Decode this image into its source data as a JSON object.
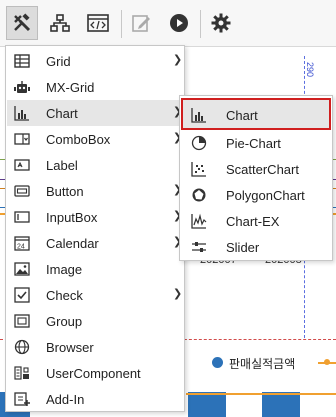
{
  "toolbar": {
    "buttons": [
      {
        "name": "tools-icon",
        "active": true
      },
      {
        "name": "tree-icon"
      },
      {
        "name": "code-window-icon"
      },
      {
        "name": "edit-icon"
      },
      {
        "name": "play-icon"
      },
      {
        "name": "gear-icon"
      }
    ]
  },
  "background": {
    "vertical_marker_label": "290",
    "x_labels": [
      "202007",
      "202008"
    ],
    "legend_label": "판매실적금액"
  },
  "menu": {
    "items": [
      {
        "label": "Grid",
        "icon": "grid-icon",
        "has_submenu": true
      },
      {
        "label": "MX-Grid",
        "icon": "robot-icon",
        "has_submenu": false
      },
      {
        "label": "Chart",
        "icon": "bar-chart-icon",
        "has_submenu": true
      },
      {
        "label": "ComboBox",
        "icon": "combobox-icon",
        "has_submenu": true
      },
      {
        "label": "Label",
        "icon": "label-icon",
        "has_submenu": false
      },
      {
        "label": "Button",
        "icon": "button-icon",
        "has_submenu": true
      },
      {
        "label": "InputBox",
        "icon": "inputbox-icon",
        "has_submenu": true
      },
      {
        "label": "Calendar",
        "icon": "calendar-icon",
        "has_submenu": true
      },
      {
        "label": "Image",
        "icon": "image-icon",
        "has_submenu": false
      },
      {
        "label": "Check",
        "icon": "checkbox-icon",
        "has_submenu": true
      },
      {
        "label": "Group",
        "icon": "group-icon",
        "has_submenu": false
      },
      {
        "label": "Browser",
        "icon": "globe-icon",
        "has_submenu": false
      },
      {
        "label": "UserComponent",
        "icon": "user-component-icon",
        "has_submenu": false
      },
      {
        "label": "Add-In",
        "icon": "add-in-icon",
        "has_submenu": false
      }
    ],
    "highlighted": "Chart"
  },
  "submenu": {
    "items": [
      {
        "label": "Chart",
        "icon": "bar-chart-icon"
      },
      {
        "label": "Pie-Chart",
        "icon": "pie-chart-icon"
      },
      {
        "label": "ScatterChart",
        "icon": "scatter-chart-icon"
      },
      {
        "label": "PolygonChart",
        "icon": "polygon-chart-icon"
      },
      {
        "label": "Chart-EX",
        "icon": "chart-ex-icon"
      },
      {
        "label": "Slider",
        "icon": "slider-icon"
      }
    ],
    "selected": "Chart"
  },
  "colors": {
    "selection_border": "#d01f1f",
    "hover_background": "#e6e6e6",
    "series_blue": "#2c72b8",
    "series_orange": "#f0a030"
  }
}
